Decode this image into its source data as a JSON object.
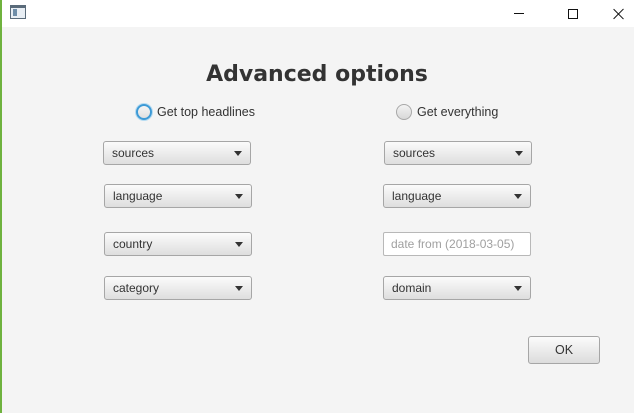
{
  "titlebar": {
    "icons": {
      "app": "window-app-icon",
      "minimize": "minimize-icon",
      "maximize": "maximize-icon",
      "close": "close-icon"
    }
  },
  "heading": "Advanced options",
  "left": {
    "radio_label": "Get top headlines",
    "radio_selected": true,
    "combos": {
      "sources": "sources",
      "language": "language",
      "country": "country",
      "category": "category"
    }
  },
  "right": {
    "radio_label": "Get everything",
    "radio_selected": false,
    "combos": {
      "sources": "sources",
      "language": "language",
      "domain": "domain"
    },
    "date_from_placeholder": "date from (2018-03-05)"
  },
  "ok_label": "OK",
  "colors": {
    "focus_ring": "#3d9ad6",
    "window_background": "#f4f4f4",
    "window_accent_edge": "#6fb23e"
  }
}
